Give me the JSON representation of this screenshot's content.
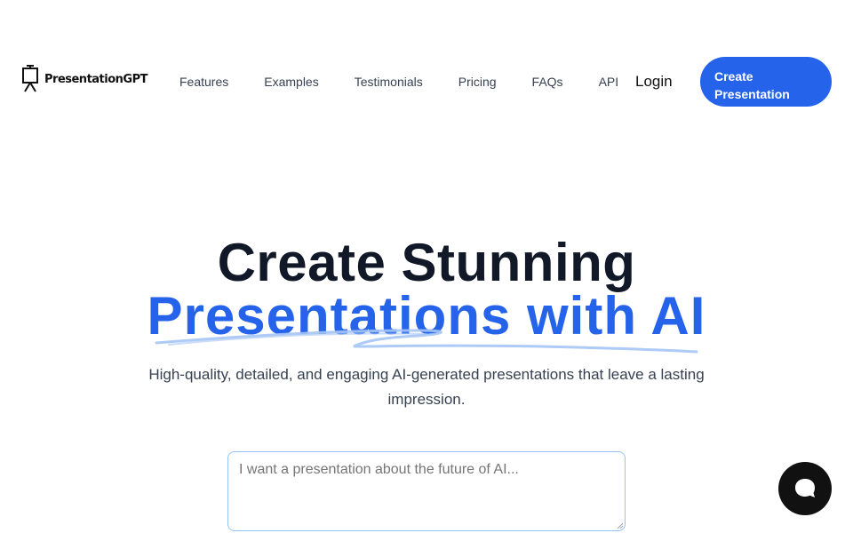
{
  "header": {
    "logo_text": "PresentationGPT",
    "nav": [
      "Features",
      "Examples",
      "Testimonials",
      "Pricing",
      "FAQs",
      "API"
    ],
    "login_label": "Login",
    "cta_label_line1": "Create",
    "cta_label_line2": "Presentation"
  },
  "hero": {
    "title_line1": "Create Stunning",
    "title_line2": "Presentations with AI",
    "subtitle": "High-quality, detailed, and engaging AI-generated presentations that leave a lasting impression."
  },
  "prompt": {
    "placeholder": "I want a presentation about the future of AI...",
    "value": ""
  },
  "colors": {
    "accent": "#2563eb",
    "text": "#111827",
    "muted": "#374151",
    "input_border": "#93c5fd",
    "chat_bg": "#111111"
  },
  "icons": {
    "logo": "presentation-easel-icon",
    "chat": "chat-bubble-icon",
    "scribble": "underline-scribble"
  }
}
